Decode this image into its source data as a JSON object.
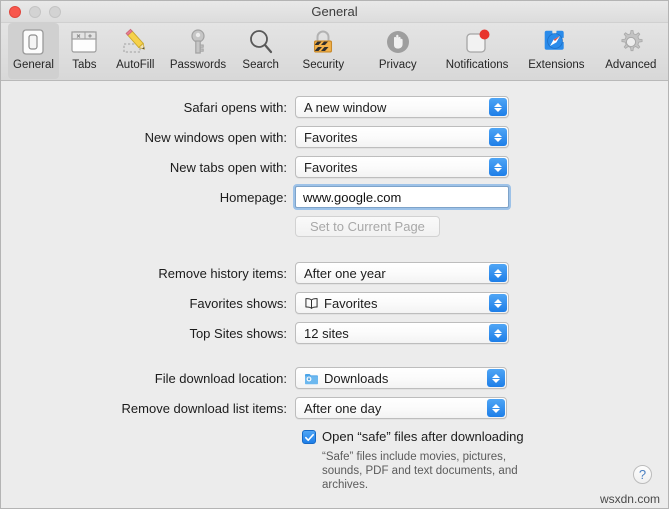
{
  "window": {
    "title": "General",
    "traffic_lights": [
      "close",
      "minimize",
      "zoom"
    ]
  },
  "toolbar": {
    "items": [
      {
        "label": "General",
        "icon": "general-icon",
        "selected": true
      },
      {
        "label": "Tabs",
        "icon": "tabs-icon",
        "selected": false
      },
      {
        "label": "AutoFill",
        "icon": "autofill-icon",
        "selected": false
      },
      {
        "label": "Passwords",
        "icon": "passwords-key-icon",
        "selected": false
      },
      {
        "label": "Search",
        "icon": "search-magnifier-icon",
        "selected": false
      },
      {
        "label": "Security",
        "icon": "security-lock-icon",
        "selected": false
      },
      {
        "label": "Privacy",
        "icon": "privacy-hand-icon",
        "selected": false
      },
      {
        "label": "Notifications",
        "icon": "notifications-badge-icon",
        "selected": false
      },
      {
        "label": "Extensions",
        "icon": "extensions-puzzle-icon",
        "selected": false
      },
      {
        "label": "Advanced",
        "icon": "advanced-gear-icon",
        "selected": false
      }
    ]
  },
  "form": {
    "safari_opens_with": {
      "label": "Safari opens with:",
      "value": "A new window"
    },
    "new_windows_open_with": {
      "label": "New windows open with:",
      "value": "Favorites"
    },
    "new_tabs_open_with": {
      "label": "New tabs open with:",
      "value": "Favorites"
    },
    "homepage": {
      "label": "Homepage:",
      "value": "www.google.com"
    },
    "set_to_current_page": {
      "label": "Set to Current Page",
      "enabled": false
    },
    "remove_history_items": {
      "label": "Remove history items:",
      "value": "After one year"
    },
    "favorites_shows": {
      "label": "Favorites shows:",
      "value": "Favorites",
      "icon": "book-icon"
    },
    "top_sites_shows": {
      "label": "Top Sites shows:",
      "value": "12 sites"
    },
    "file_download_location": {
      "label": "File download location:",
      "value": "Downloads",
      "icon": "downloads-folder-icon"
    },
    "remove_download_list": {
      "label": "Remove download list items:",
      "value": "After one day"
    },
    "open_safe_files": {
      "label": "Open “safe” files after downloading",
      "checked": true,
      "description": "“Safe” files include movies, pictures, sounds, PDF and text documents, and archives."
    }
  },
  "help_button": {
    "glyph": "?"
  },
  "watermark": "wsxdn.com",
  "colors": {
    "accent_blue": "#1d7ee8",
    "window_bg": "#ececec",
    "toolbar_bg": "#dedede",
    "close_red": "#f8574d",
    "badge_red": "#e8342c"
  }
}
